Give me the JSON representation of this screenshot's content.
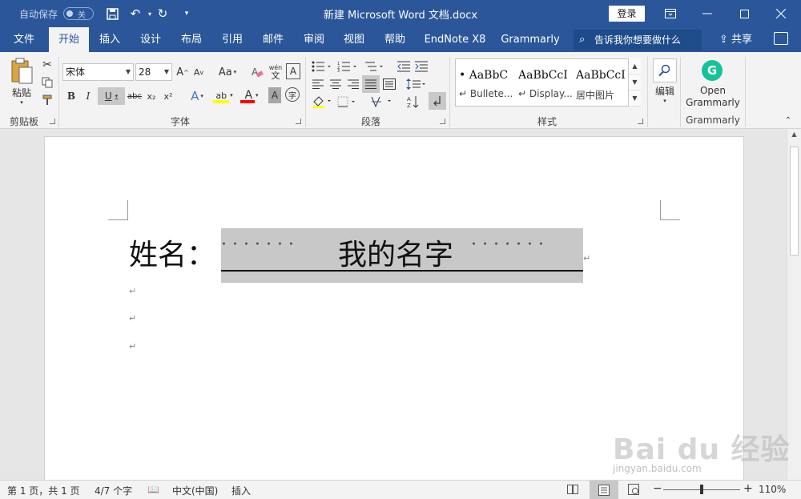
{
  "titlebar": {
    "autosave_label": "自动保存",
    "autosave_state": "关",
    "doc_title": "新建 Microsoft Word 文档.docx",
    "login_label": "登录"
  },
  "tabs": [
    {
      "label": "文件",
      "active": false
    },
    {
      "label": "开始",
      "active": true
    },
    {
      "label": "插入",
      "active": false
    },
    {
      "label": "设计",
      "active": false
    },
    {
      "label": "布局",
      "active": false
    },
    {
      "label": "引用",
      "active": false
    },
    {
      "label": "邮件",
      "active": false
    },
    {
      "label": "审阅",
      "active": false
    },
    {
      "label": "视图",
      "active": false
    },
    {
      "label": "帮助",
      "active": false
    },
    {
      "label": "EndNote X8",
      "active": false
    },
    {
      "label": "Grammarly",
      "active": false
    }
  ],
  "tellme_placeholder": "告诉我你想要做什么",
  "share_label": "共享",
  "ribbon": {
    "clipboard": {
      "paste_label": "粘贴",
      "group_label": "剪贴板"
    },
    "font": {
      "font_name": "宋体",
      "font_size": "28",
      "grow_label": "A",
      "shrink_label": "A",
      "case_label": "Aa",
      "pinyin_top": "wén",
      "pinyin_bottom": "文",
      "border_char_label": "A",
      "bold_label": "B",
      "italic_label": "I",
      "underline_label": "U",
      "strike_label": "abc",
      "sub_label": "x₂",
      "sup_label": "x²",
      "effects_label": "A",
      "highlight_label": "ab",
      "color_label": "A",
      "shading_label": "A",
      "enclose_label": "字",
      "group_label": "字体"
    },
    "paragraph": {
      "group_label": "段落"
    },
    "styles": {
      "items": [
        {
          "sample": "• AaBbC",
          "name": "↵ Bullete..."
        },
        {
          "sample": "AaBbCcI",
          "name": "↵ Display..."
        },
        {
          "sample": "AaBbCcI",
          "name": "居中图片"
        }
      ],
      "group_label": "样式"
    },
    "editing": {
      "label": "编辑"
    },
    "grammarly": {
      "button_label_1": "Open",
      "button_label_2": "Grammarly",
      "group_label": "Grammarly"
    }
  },
  "document": {
    "field_label": "姓名：",
    "field_value": "我的名字",
    "dots": "·······"
  },
  "status": {
    "page": "第 1 页，共 1 页",
    "words": "4/7 个字",
    "language": "中文(中国)",
    "mode": "插入",
    "zoom": "110%"
  },
  "watermark": {
    "text": "Bai du 经验",
    "url": "jingyan.baidu.com"
  },
  "colors": {
    "accent": "#2b579a",
    "highlight": "#ffff00",
    "font_color": "#ff0000",
    "grammarly": "#15c39a"
  }
}
